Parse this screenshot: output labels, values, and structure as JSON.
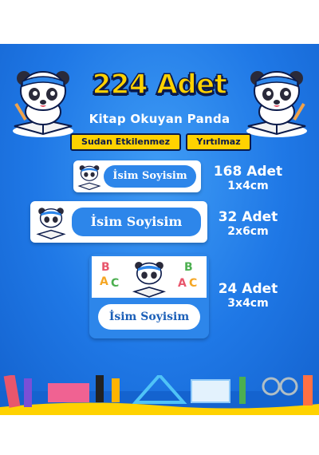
{
  "header": {
    "title": "224 Adet",
    "subtitle": "Kitap Okuyan Panda",
    "badge_waterproof": "Sudan Etkilenmez",
    "badge_tearproof": "Yırtılmaz"
  },
  "products": [
    {
      "name_text": "İsim Soyisim",
      "count": "168 Adet",
      "size": "1x4cm"
    },
    {
      "name_text": "İsim Soyisim",
      "count": "32 Adet",
      "size": "2x6cm"
    },
    {
      "name_text": "İsim Soyisim",
      "count": "24 Adet",
      "size": "3x4cm",
      "letters": [
        "B",
        "A",
        "C",
        "B",
        "A",
        "C"
      ]
    }
  ],
  "colors": {
    "background": "#1f78e6",
    "title_yellow": "#ffd200",
    "label_blue": "#2d86ea",
    "outline_navy": "#0b1a4a"
  },
  "icons": [
    "panda-mascot-icon",
    "pencil-icon",
    "book-icon",
    "school-supplies-illustration"
  ]
}
